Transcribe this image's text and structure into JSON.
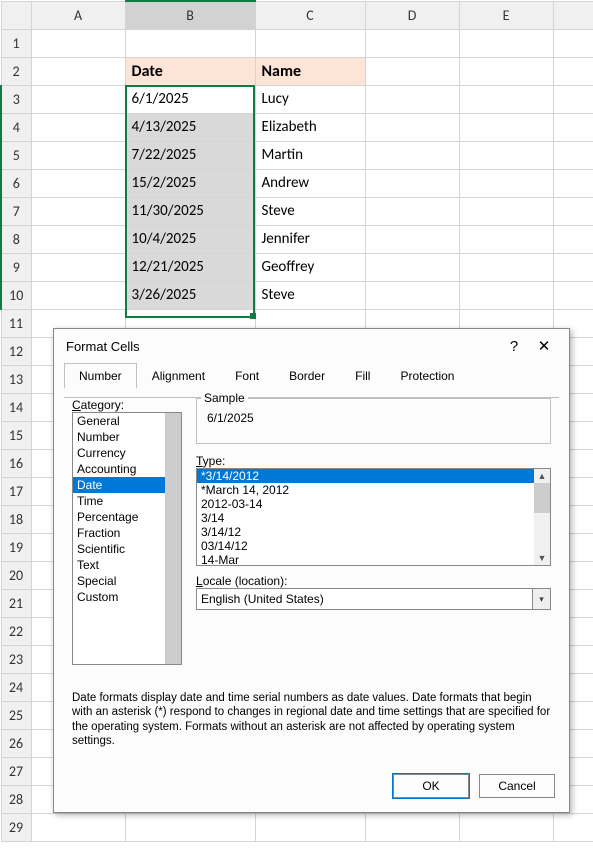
{
  "columns": [
    "A",
    "B",
    "C",
    "D",
    "E",
    ""
  ],
  "rows": [
    {
      "n": 1,
      "cells": [
        "",
        "",
        "",
        "",
        "",
        ""
      ]
    },
    {
      "n": 2,
      "hdr": true,
      "cells": [
        "",
        "Date",
        "Name",
        "",
        "",
        ""
      ]
    },
    {
      "n": 3,
      "sel": true,
      "active": true,
      "cells": [
        "",
        "6/1/2025",
        "Lucy",
        "",
        "",
        ""
      ]
    },
    {
      "n": 4,
      "sel": true,
      "cells": [
        "",
        "4/13/2025",
        "Elizabeth",
        "",
        "",
        ""
      ]
    },
    {
      "n": 5,
      "sel": true,
      "cells": [
        "",
        "7/22/2025",
        "Martin",
        "",
        "",
        ""
      ]
    },
    {
      "n": 6,
      "sel": true,
      "cells": [
        "",
        "15/2/2025",
        "Andrew",
        "",
        "",
        ""
      ]
    },
    {
      "n": 7,
      "sel": true,
      "cells": [
        "",
        "11/30/2025",
        "Steve",
        "",
        "",
        ""
      ]
    },
    {
      "n": 8,
      "sel": true,
      "cells": [
        "",
        "10/4/2025",
        "Jennifer",
        "",
        "",
        ""
      ]
    },
    {
      "n": 9,
      "sel": true,
      "cells": [
        "",
        "12/21/2025",
        "Geoffrey",
        "",
        "",
        ""
      ]
    },
    {
      "n": 10,
      "sel": true,
      "cells": [
        "",
        "3/26/2025",
        "Steve",
        "",
        "",
        ""
      ]
    },
    {
      "n": 11,
      "cells": [
        "",
        "",
        "",
        "",
        "",
        ""
      ]
    },
    {
      "n": 12,
      "cells": [
        "",
        "",
        "",
        "",
        "",
        ""
      ]
    },
    {
      "n": 13,
      "cells": [
        "",
        "",
        "",
        "",
        "",
        ""
      ]
    },
    {
      "n": 14,
      "cells": [
        "",
        "",
        "",
        "",
        "",
        ""
      ]
    },
    {
      "n": 15,
      "cells": [
        "",
        "",
        "",
        "",
        "",
        ""
      ]
    },
    {
      "n": 16,
      "cells": [
        "",
        "",
        "",
        "",
        "",
        ""
      ]
    },
    {
      "n": 17,
      "cells": [
        "",
        "",
        "",
        "",
        "",
        ""
      ]
    },
    {
      "n": 18,
      "cells": [
        "",
        "",
        "",
        "",
        "",
        ""
      ]
    },
    {
      "n": 19,
      "cells": [
        "",
        "",
        "",
        "",
        "",
        ""
      ]
    },
    {
      "n": 20,
      "cells": [
        "",
        "",
        "",
        "",
        "",
        ""
      ]
    },
    {
      "n": 21,
      "cells": [
        "",
        "",
        "",
        "",
        "",
        ""
      ]
    },
    {
      "n": 22,
      "cells": [
        "",
        "",
        "",
        "",
        "",
        ""
      ]
    },
    {
      "n": 23,
      "cells": [
        "",
        "",
        "",
        "",
        "",
        ""
      ]
    },
    {
      "n": 24,
      "cells": [
        "",
        "",
        "",
        "",
        "",
        ""
      ]
    },
    {
      "n": 25,
      "cells": [
        "",
        "",
        "",
        "",
        "",
        ""
      ]
    },
    {
      "n": 26,
      "cells": [
        "",
        "",
        "",
        "",
        "",
        ""
      ]
    },
    {
      "n": 27,
      "cells": [
        "",
        "",
        "",
        "",
        "",
        ""
      ]
    },
    {
      "n": 28,
      "cells": [
        "",
        "",
        "",
        "",
        "",
        ""
      ]
    },
    {
      "n": 29,
      "cells": [
        "",
        "",
        "",
        "",
        "",
        ""
      ]
    }
  ],
  "dialog": {
    "title": "Format Cells",
    "help": "?",
    "close": "✕",
    "tabs": [
      "Number",
      "Alignment",
      "Font",
      "Border",
      "Fill",
      "Protection"
    ],
    "active_tab": 0,
    "category_label": "Category:",
    "categories": [
      "General",
      "Number",
      "Currency",
      "Accounting",
      "Date",
      "Time",
      "Percentage",
      "Fraction",
      "Scientific",
      "Text",
      "Special",
      "Custom"
    ],
    "selected_category": 4,
    "sample_label": "Sample",
    "sample_value": "6/1/2025",
    "type_label": "Type:",
    "types": [
      "*3/14/2012",
      "*March 14, 2012",
      "2012-03-14",
      "3/14",
      "3/14/12",
      "03/14/12",
      "14-Mar"
    ],
    "selected_type": 0,
    "locale_label": "Locale (location):",
    "locale_value": "English (United States)",
    "description": "Date formats display date and time serial numbers as date values.  Date formats that begin with an asterisk (*) respond to changes in regional date and time settings that are specified for the operating system. Formats without an asterisk are not affected by operating system settings.",
    "ok": "OK",
    "cancel": "Cancel"
  }
}
